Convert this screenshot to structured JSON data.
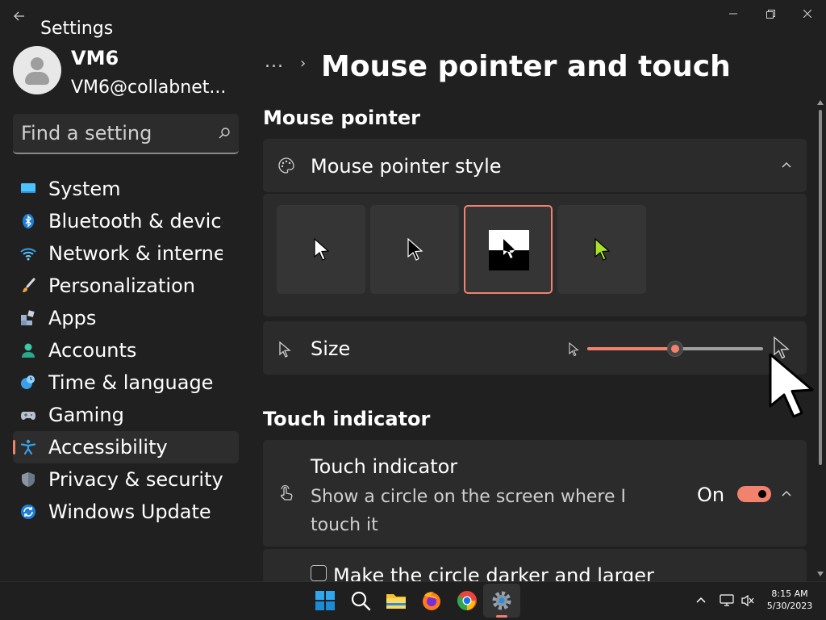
{
  "window": {
    "app_title": "Settings",
    "back_icon": "back-arrow-icon",
    "controls": [
      "minimize-icon",
      "maximize-icon",
      "close-icon"
    ]
  },
  "user": {
    "name": "VM6",
    "email": "VM6@collabnet..."
  },
  "search": {
    "placeholder": "Find a setting",
    "value": ""
  },
  "sidebar": {
    "items": [
      {
        "label": "System",
        "icon": "system-icon"
      },
      {
        "label": "Bluetooth & devices",
        "icon": "bluetooth-icon"
      },
      {
        "label": "Network & internet",
        "icon": "network-icon"
      },
      {
        "label": "Personalization",
        "icon": "personalization-icon"
      },
      {
        "label": "Apps",
        "icon": "apps-icon"
      },
      {
        "label": "Accounts",
        "icon": "accounts-icon"
      },
      {
        "label": "Time & language",
        "icon": "time-language-icon"
      },
      {
        "label": "Gaming",
        "icon": "gaming-icon"
      },
      {
        "label": "Accessibility",
        "icon": "accessibility-icon",
        "active": true
      },
      {
        "label": "Privacy & security",
        "icon": "privacy-icon"
      },
      {
        "label": "Windows Update",
        "icon": "windows-update-icon"
      }
    ]
  },
  "header": {
    "breadcrumb_more": "...",
    "title": "Mouse pointer and touch"
  },
  "mouse_pointer": {
    "section_title": "Mouse pointer",
    "style_label": "Mouse pointer style",
    "style_options": [
      "white",
      "black",
      "inverted",
      "custom"
    ],
    "selected_style": "inverted",
    "size_label": "Size",
    "size_value_fraction": 0.5
  },
  "touch": {
    "section_title": "Touch indicator",
    "title": "Touch indicator",
    "description": "Show a circle on the screen where I touch it",
    "state_label": "On",
    "enabled": true,
    "checkbox_label": "Make the circle darker and larger",
    "checkbox_checked": false
  },
  "taskbar": {
    "apps": [
      "start-icon",
      "search-icon",
      "file-explorer-icon",
      "firefox-icon",
      "chrome-icon",
      "settings-icon"
    ],
    "time": "8:15 AM",
    "date": "5/30/2023"
  },
  "colors": {
    "accent": "#f0826e",
    "background": "#202020",
    "card": "#2b2b2b"
  }
}
